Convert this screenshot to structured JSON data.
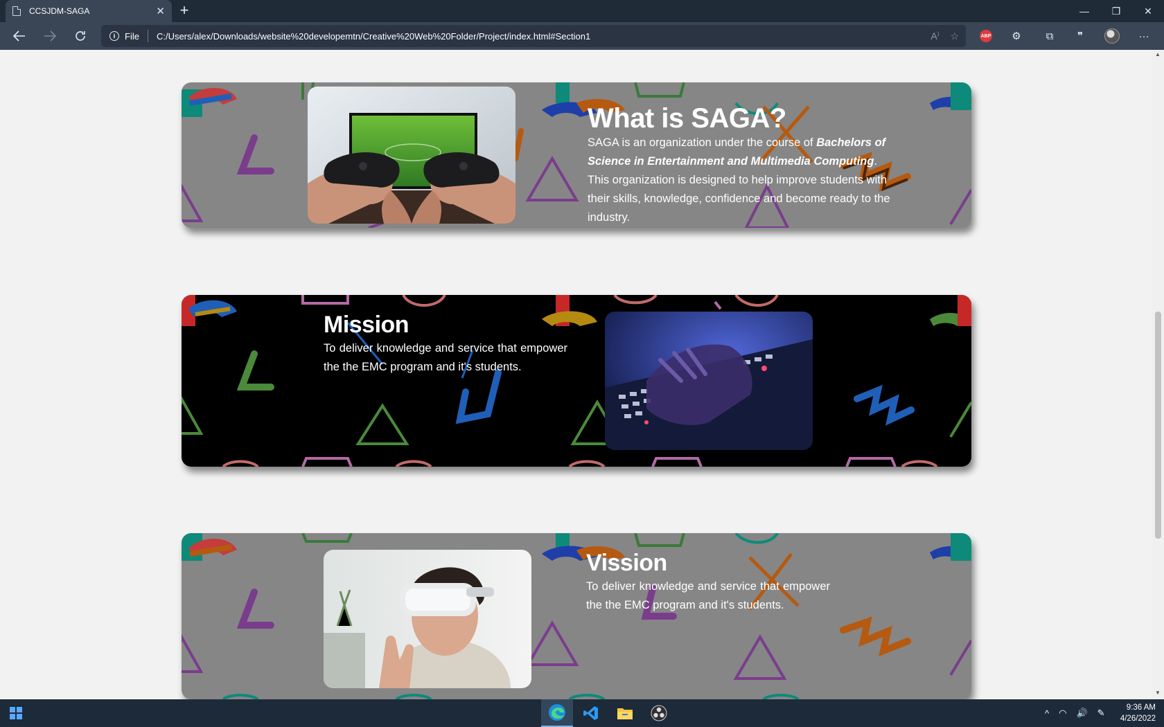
{
  "browser": {
    "tab_title": "CCSJDM-SAGA",
    "tab_close": "✕",
    "new_tab": "+",
    "address_prefix": "File",
    "url": "C:/Users/alex/Downloads/website%20developemtn/Creative%20Web%20Folder/Project/index.html#Section1",
    "abp_label": "ABP",
    "window_controls": [
      "—",
      "❐",
      "✕"
    ]
  },
  "sections": [
    {
      "title": "What is SAGA?",
      "text_before": "SAGA is an organization under the course of ",
      "text_emphasis": "Bachelors of Science in Entertainment and Multimedia Computing",
      "text_after": ". This organization is designed to help improve students with their skills, knowledge, confidence and become ready to the industry."
    },
    {
      "title": "Mission",
      "text": "To deliver knowledge and service that empower the the EMC program and it's students."
    },
    {
      "title": "Vission",
      "text": "To deliver knowledge and service that empower the the EMC program and it's students."
    }
  ],
  "taskbar": {
    "time": "9:36 AM",
    "date": "4/26/2022"
  },
  "colors": {
    "gray_section": "#868686",
    "black_section": "#000000",
    "pattern_purple": "#7a3d8c",
    "pattern_orange": "#b55a10",
    "pattern_blue": "#1f5fb8",
    "pattern_green": "#4a8a3a",
    "pattern_pink": "#b26aa4"
  }
}
